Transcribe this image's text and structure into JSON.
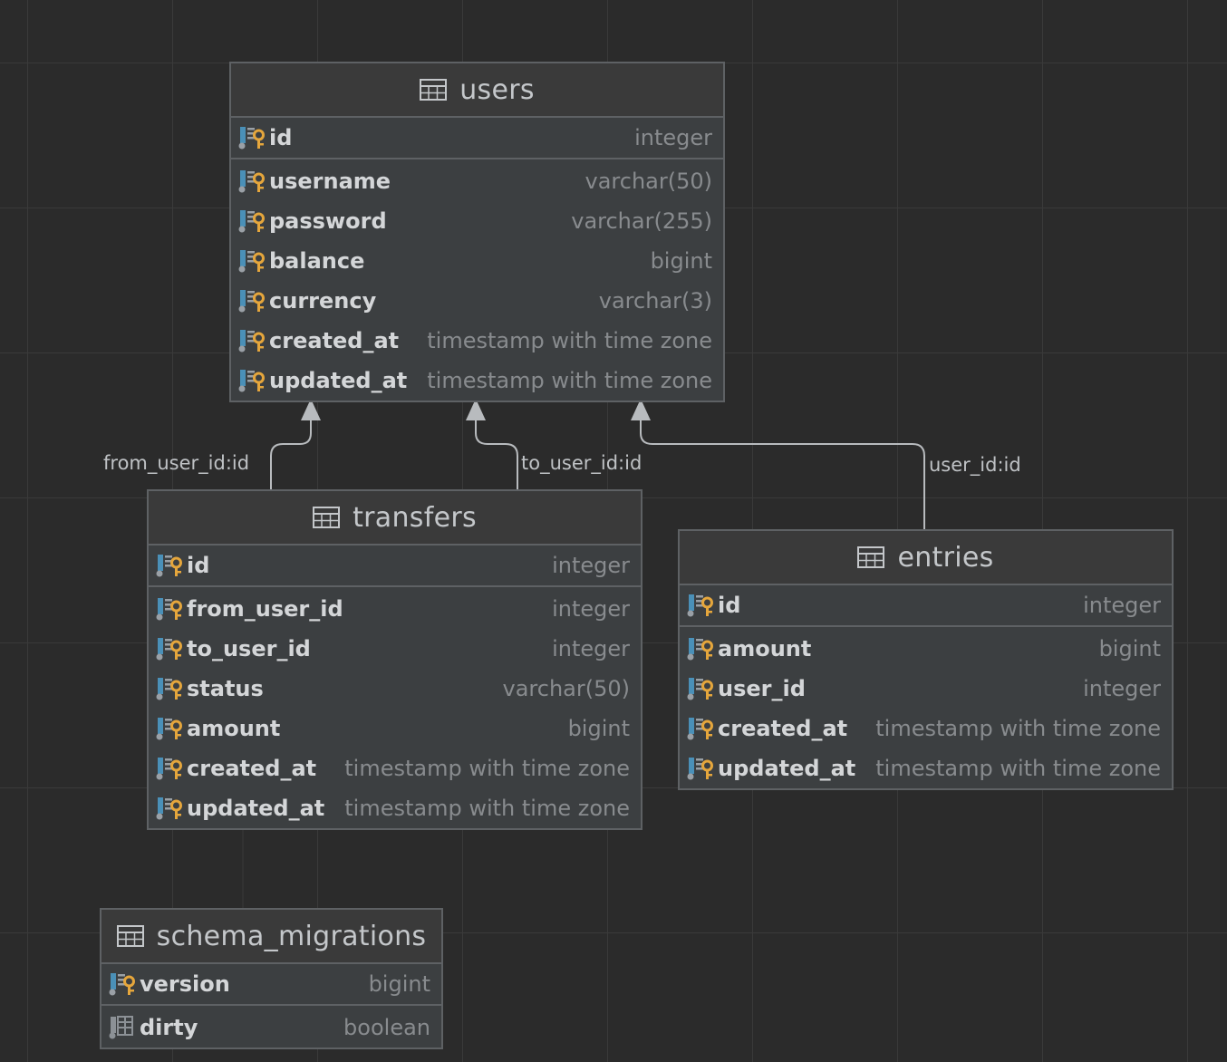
{
  "tables": [
    {
      "key": "users",
      "name": "users",
      "columns": [
        {
          "name": "id",
          "type": "integer",
          "primary": true,
          "icon": "primary-key-column-icon"
        },
        {
          "name": "username",
          "type": "varchar(50)",
          "icon": "key-column-icon"
        },
        {
          "name": "password",
          "type": "varchar(255)",
          "icon": "key-column-icon"
        },
        {
          "name": "balance",
          "type": "bigint",
          "icon": "key-column-icon"
        },
        {
          "name": "currency",
          "type": "varchar(3)",
          "icon": "key-column-icon"
        },
        {
          "name": "created_at",
          "type": "timestamp with time zone",
          "icon": "key-column-icon"
        },
        {
          "name": "updated_at",
          "type": "timestamp with time zone",
          "icon": "key-column-icon"
        }
      ]
    },
    {
      "key": "transfers",
      "name": "transfers",
      "columns": [
        {
          "name": "id",
          "type": "integer",
          "primary": true,
          "icon": "primary-key-column-icon"
        },
        {
          "name": "from_user_id",
          "type": "integer",
          "icon": "key-column-icon"
        },
        {
          "name": "to_user_id",
          "type": "integer",
          "icon": "key-column-icon"
        },
        {
          "name": "status",
          "type": "varchar(50)",
          "icon": "key-column-icon"
        },
        {
          "name": "amount",
          "type": "bigint",
          "icon": "key-column-icon"
        },
        {
          "name": "created_at",
          "type": "timestamp with time zone",
          "icon": "key-column-icon"
        },
        {
          "name": "updated_at",
          "type": "timestamp with time zone",
          "icon": "key-column-icon"
        }
      ]
    },
    {
      "key": "entries",
      "name": "entries",
      "columns": [
        {
          "name": "id",
          "type": "integer",
          "primary": true,
          "icon": "primary-key-column-icon"
        },
        {
          "name": "amount",
          "type": "bigint",
          "icon": "key-column-icon"
        },
        {
          "name": "user_id",
          "type": "integer",
          "icon": "key-column-icon"
        },
        {
          "name": "created_at",
          "type": "timestamp with time zone",
          "icon": "key-column-icon"
        },
        {
          "name": "updated_at",
          "type": "timestamp with time zone",
          "icon": "key-column-icon"
        }
      ]
    },
    {
      "key": "schema_migrations",
      "name": "schema_migrations",
      "columns": [
        {
          "name": "version",
          "type": "bigint",
          "primary": true,
          "icon": "primary-key-column-icon"
        },
        {
          "name": "dirty",
          "type": "boolean",
          "icon": "column-icon"
        }
      ]
    }
  ],
  "relations": [
    {
      "from": "transfers",
      "to": "users",
      "label": "from_user_id:id"
    },
    {
      "from": "transfers",
      "to": "users",
      "label": "to_user_id:id"
    },
    {
      "from": "entries",
      "to": "users",
      "label": "user_id:id"
    }
  ],
  "colors": {
    "background": "#2b2b2b",
    "grid": "#3a3a3a",
    "card": "#3c3f41",
    "border": "#5e6164",
    "connector": "#b8bbbe",
    "key_icon": "#e5a63c",
    "column_icon": "#4a90b8"
  }
}
